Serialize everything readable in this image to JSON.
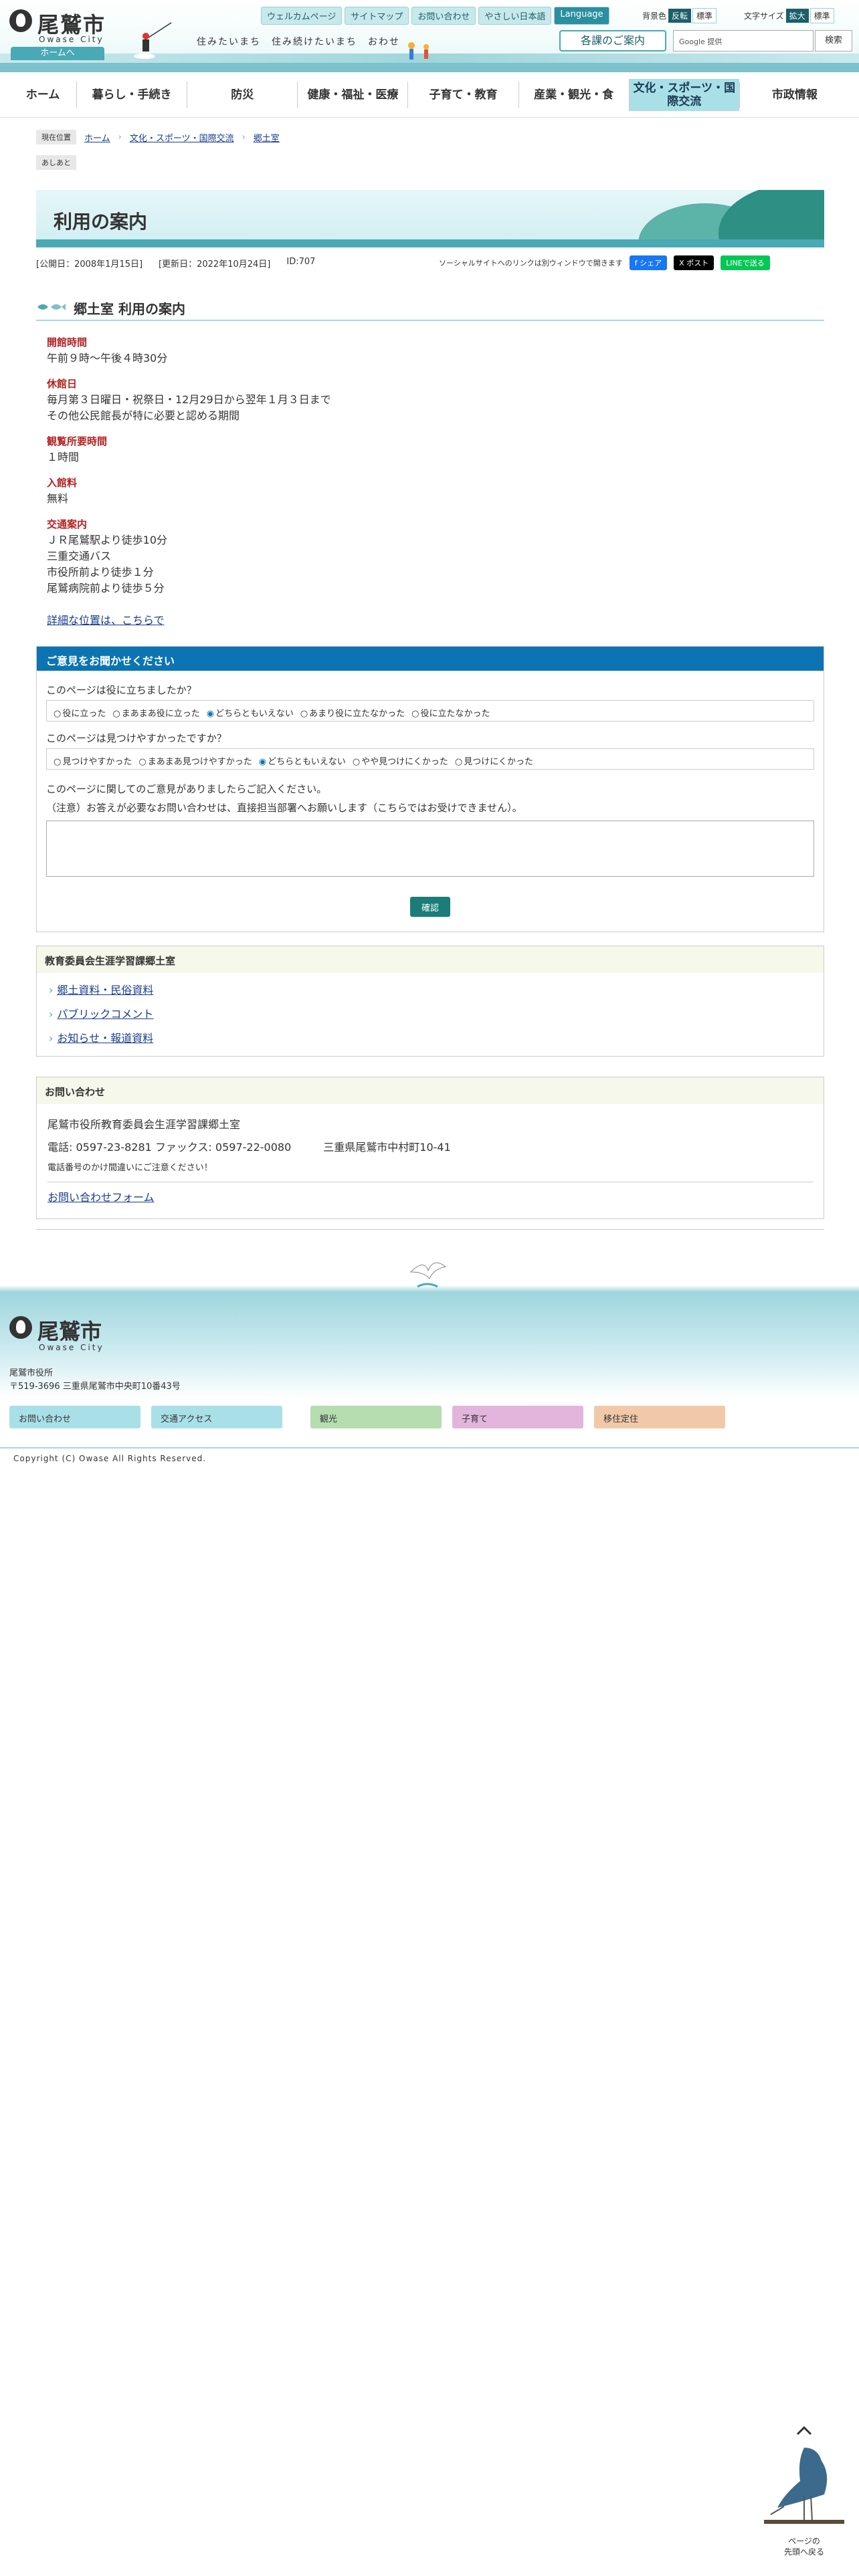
{
  "header": {
    "logo_name": "尾鷲市",
    "logo_sub": "Owase City",
    "home_link": "ホームへ",
    "catchcopy": "住みたいまち　住み続けたいまち　おわせ",
    "util_links": [
      "ウェルカムページ",
      "サイトマップ",
      "お問い合わせ",
      "やさしい日本語",
      "Language"
    ],
    "color_label": "背景色",
    "color_on": "反転",
    "color_std": "標準",
    "font_label": "文字サイズ",
    "font_big": "拡大",
    "font_std": "標準",
    "guide_button": "各課のご案内",
    "search_placeholder": "Google 提供",
    "search_button": "検索"
  },
  "gnav": [
    "ホーム",
    "暮らし・手続き",
    "防災",
    "健康・福祉・医療",
    "子育て・教育",
    "産業・観光・食",
    "文化・スポーツ・国際交流",
    "市政情報"
  ],
  "breadcrumb": {
    "label": "現在位置",
    "items": [
      "ホーム",
      "文化・スポーツ・国際交流",
      "郷土室"
    ]
  },
  "footprint": "あしあと",
  "page_title": "利用の案内",
  "meta": {
    "published": "[公開日：2008年1月15日]",
    "updated": "[更新日：2022年10月24日]",
    "id": "ID:707"
  },
  "social": {
    "note": "ソーシャルサイトへのリンクは別ウィンドウで開きます",
    "facebook": "f シェア",
    "x": "X ポスト",
    "line": "LINEで送る"
  },
  "section_title": "郷土室 利用の案内",
  "info": [
    {
      "term": "開館時間",
      "desc": [
        "午前９時～午後４時30分"
      ]
    },
    {
      "term": "休館日",
      "desc": [
        "毎月第３日曜日・祝祭日・12月29日から翌年１月３日まで",
        "その他公民館長が特に必要と認める期間"
      ]
    },
    {
      "term": "観覧所要時間",
      "desc": [
        "１時間"
      ]
    },
    {
      "term": "入館料",
      "desc": [
        "無料"
      ]
    },
    {
      "term": "交通案内",
      "desc": [
        "ＪＲ尾鷲駅より徒歩10分",
        "三重交通バス",
        "市役所前より徒歩１分",
        "尾鷲病院前より徒歩５分"
      ]
    }
  ],
  "detail_link": "詳細な位置は、こちらで",
  "enquete": {
    "title": "ご意見をお聞かせください",
    "q1": "このページは役に立ちましたか？",
    "q1_options": [
      "役に立った",
      "まあまあ役に立った",
      "どちらともいえない",
      "あまり役に立たなかった",
      "役に立たなかった"
    ],
    "q1_selected": 2,
    "q2": "このページは見つけやすかったですか？",
    "q2_options": [
      "見つけやすかった",
      "まあまあ見つけやすかった",
      "どちらともいえない",
      "やや見つけにくかった",
      "見つけにくかった"
    ],
    "q2_selected": 2,
    "comment_label": "このページに関してのご意見がありましたらご記入ください。",
    "notice": "（注意）お答えが必要なお問い合わせは、直接担当部署へお願いします（こちらではお受けできません）。",
    "confirm": "確認"
  },
  "related": {
    "title": "教育委員会生涯学習課郷土室",
    "links": [
      "郷土資料・民俗資料",
      "パブリックコメント",
      "お知らせ・報道資料"
    ]
  },
  "contact": {
    "title": "お問い合わせ",
    "dept": "尾鷲市役所教育委員会生涯学習課郷土室",
    "phone": "電話: 0597-23-8281 ファックス: 0597-22-0080",
    "address": "三重県尾鷲市中村町10-41",
    "note": "電話番号のかけ間違いにご注意ください！",
    "form_link": "お問い合わせフォーム"
  },
  "footer": {
    "logo_name": "尾鷲市",
    "logo_sub": "Owase City",
    "office": "尾鷲市役所",
    "address": "〒519-3696 三重県尾鷲市中央町10番43号",
    "buttons": [
      "お問い合わせ",
      "交通アクセス",
      "観光",
      "子育て",
      "移住定住"
    ],
    "button_colors": [
      "#a9e0e7",
      "#a9e0e7",
      "#b5ddb0",
      "#e3b5dc",
      "#f2c9a8"
    ],
    "copyright": "Copyright (C) Owase All Rights Reserved."
  },
  "pagetop": "ページの\n先頭へ戻る"
}
